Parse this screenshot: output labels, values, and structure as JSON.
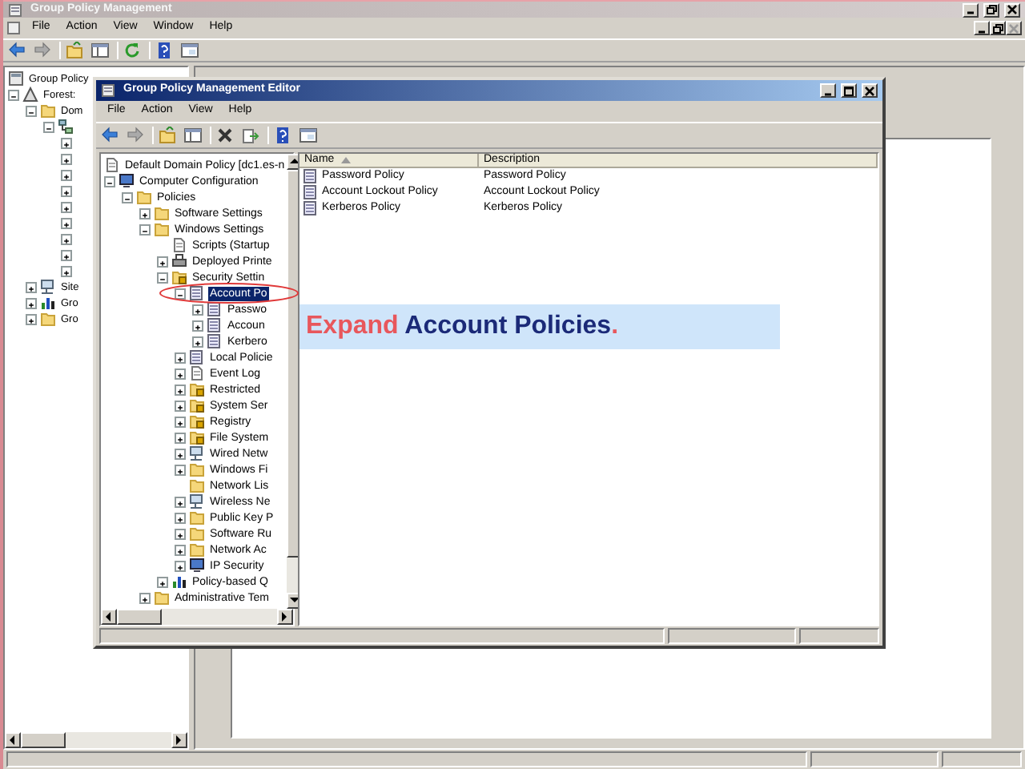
{
  "main_window": {
    "title": "Group Policy Management",
    "menu": [
      "File",
      "Action",
      "View",
      "Window",
      "Help"
    ],
    "tree": [
      {
        "label": "Group Policy",
        "kind": "console",
        "selected": false,
        "children": [
          {
            "label": "Forest:",
            "kind": "forest",
            "expanded": true,
            "selected": false,
            "children": [
              {
                "label": "Dom",
                "kind": "folder",
                "expanded": true,
                "selected": false,
                "children": [
                  {
                    "kind": "domain",
                    "expanded": true,
                    "children": [
                      {
                        "expanded": false
                      },
                      {
                        "expanded": false
                      },
                      {
                        "expanded": false
                      },
                      {
                        "expanded": false
                      },
                      {
                        "expanded": false
                      },
                      {
                        "expanded": false
                      },
                      {
                        "expanded": false
                      },
                      {
                        "expanded": false
                      },
                      {
                        "expanded": false
                      }
                    ]
                  }
                ]
              },
              {
                "label": "Site",
                "kind": "network",
                "expanded": false,
                "selected": false
              },
              {
                "label": "Gro",
                "kind": "chart",
                "expanded": false,
                "selected": false
              },
              {
                "label": "Gro",
                "kind": "folder",
                "expanded": false,
                "selected": false
              }
            ]
          }
        ]
      }
    ]
  },
  "editor": {
    "title": "Group Policy Management Editor",
    "menu": [
      "File",
      "Action",
      "View",
      "Help"
    ],
    "tree": [
      {
        "label": "Default Domain Policy [dc1.es-n",
        "kind": "document",
        "selected": false,
        "children": [
          {
            "label": "Computer Configuration",
            "kind": "computer",
            "expanded": true,
            "selected": false,
            "children": [
              {
                "label": "Policies",
                "kind": "folder",
                "expanded": true,
                "selected": false,
                "children": [
                  {
                    "label": "Software Settings",
                    "kind": "folder",
                    "expanded": false,
                    "selected": false
                  },
                  {
                    "label": "Windows Settings",
                    "kind": "folder",
                    "expanded": true,
                    "selected": false,
                    "children": [
                      {
                        "label": "Scripts (Startup",
                        "kind": "document",
                        "selected": false
                      },
                      {
                        "label": "Deployed Printe",
                        "kind": "printer",
                        "expanded": false,
                        "selected": false
                      },
                      {
                        "label": "Security Settin",
                        "kind": "locked-folder",
                        "expanded": true,
                        "selected": false,
                        "children": [
                          {
                            "label": "Account Po",
                            "kind": "policy",
                            "expanded": true,
                            "selected": true,
                            "children": [
                              {
                                "label": "Passwo",
                                "kind": "policy",
                                "expanded": false,
                                "selected": false
                              },
                              {
                                "label": "Accoun",
                                "kind": "policy",
                                "expanded": false,
                                "selected": false
                              },
                              {
                                "label": "Kerbero",
                                "kind": "policy",
                                "expanded": false,
                                "selected": false
                              }
                            ]
                          },
                          {
                            "label": "Local Policie",
                            "kind": "policy",
                            "expanded": false,
                            "selected": false
                          },
                          {
                            "label": "Event Log",
                            "kind": "document",
                            "expanded": false,
                            "selected": false
                          },
                          {
                            "label": "Restricted",
                            "kind": "locked-folder",
                            "expanded": false,
                            "selected": false
                          },
                          {
                            "label": "System Ser",
                            "kind": "locked-folder",
                            "expanded": false,
                            "selected": false
                          },
                          {
                            "label": "Registry",
                            "kind": "locked-folder",
                            "expanded": false,
                            "selected": false
                          },
                          {
                            "label": "File System",
                            "kind": "locked-folder",
                            "expanded": false,
                            "selected": false
                          },
                          {
                            "label": "Wired Netw",
                            "kind": "network",
                            "expanded": false,
                            "selected": false
                          },
                          {
                            "label": "Windows Fi",
                            "kind": "folder",
                            "expanded": false,
                            "selected": false
                          },
                          {
                            "label": "Network Lis",
                            "kind": "folder",
                            "selected": false
                          },
                          {
                            "label": "Wireless Ne",
                            "kind": "network",
                            "expanded": false,
                            "selected": false
                          },
                          {
                            "label": "Public Key P",
                            "kind": "folder",
                            "expanded": false,
                            "selected": false
                          },
                          {
                            "label": "Software Ru",
                            "kind": "folder",
                            "expanded": false,
                            "selected": false
                          },
                          {
                            "label": "Network Ac",
                            "kind": "folder",
                            "expanded": false,
                            "selected": false
                          },
                          {
                            "label": "IP Security",
                            "kind": "computer",
                            "expanded": false,
                            "selected": false
                          }
                        ]
                      },
                      {
                        "label": "Policy-based Q",
                        "kind": "chart",
                        "expanded": false,
                        "selected": false
                      }
                    ]
                  },
                  {
                    "label": "Administrative Tem",
                    "kind": "folder",
                    "expanded": false,
                    "selected": false
                  }
                ]
              }
            ]
          }
        ]
      }
    ],
    "columns": [
      {
        "label": "Name",
        "sorted": true
      },
      {
        "label": "Description",
        "sorted": false
      }
    ],
    "rows": [
      {
        "name": "Password Policy",
        "description": "Password Policy"
      },
      {
        "name": "Account Lockout Policy",
        "description": "Account Lockout Policy"
      },
      {
        "name": "Kerberos Policy",
        "description": "Kerberos Policy"
      }
    ]
  },
  "callout": {
    "segments": [
      {
        "text": "Expand ",
        "color": "#e8575c"
      },
      {
        "text": "Account Policies",
        "color": "#1b2a78"
      },
      {
        "text": ".",
        "color": "#e8575c"
      }
    ]
  }
}
